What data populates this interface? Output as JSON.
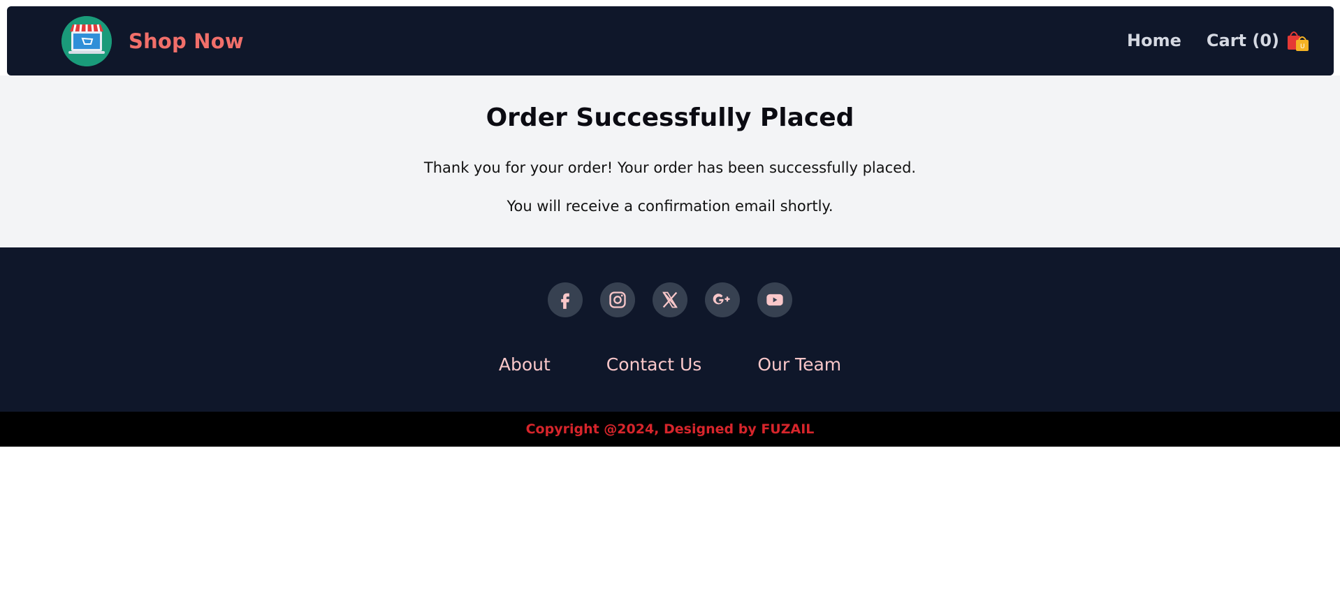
{
  "header": {
    "brand_name": "Shop Now",
    "logo_icon": "shop-storefront-laptop-icon",
    "nav": {
      "home_label": "Home",
      "cart_label": "Cart (0)",
      "cart_icon": "shopping-bag-icon"
    }
  },
  "main": {
    "title": "Order Successfully Placed",
    "message_1": "Thank you for your order! Your order has been successfully placed.",
    "message_2": "You will receive a confirmation email shortly."
  },
  "footer": {
    "socials": [
      {
        "icon": "facebook-icon"
      },
      {
        "icon": "instagram-icon"
      },
      {
        "icon": "x-twitter-icon"
      },
      {
        "icon": "google-plus-icon"
      },
      {
        "icon": "youtube-icon"
      }
    ],
    "links": [
      "About",
      "Contact Us",
      "Our Team"
    ],
    "copyright": "Copyright @2024, Designed by FUZAIL"
  },
  "colors": {
    "nav_bg": "#0f172a",
    "brand": "#f16f6a",
    "page_bg": "#f3f4f6",
    "social_bg": "#374151",
    "footer_link": "#f9c7c9",
    "copyright": "#d6252b"
  }
}
